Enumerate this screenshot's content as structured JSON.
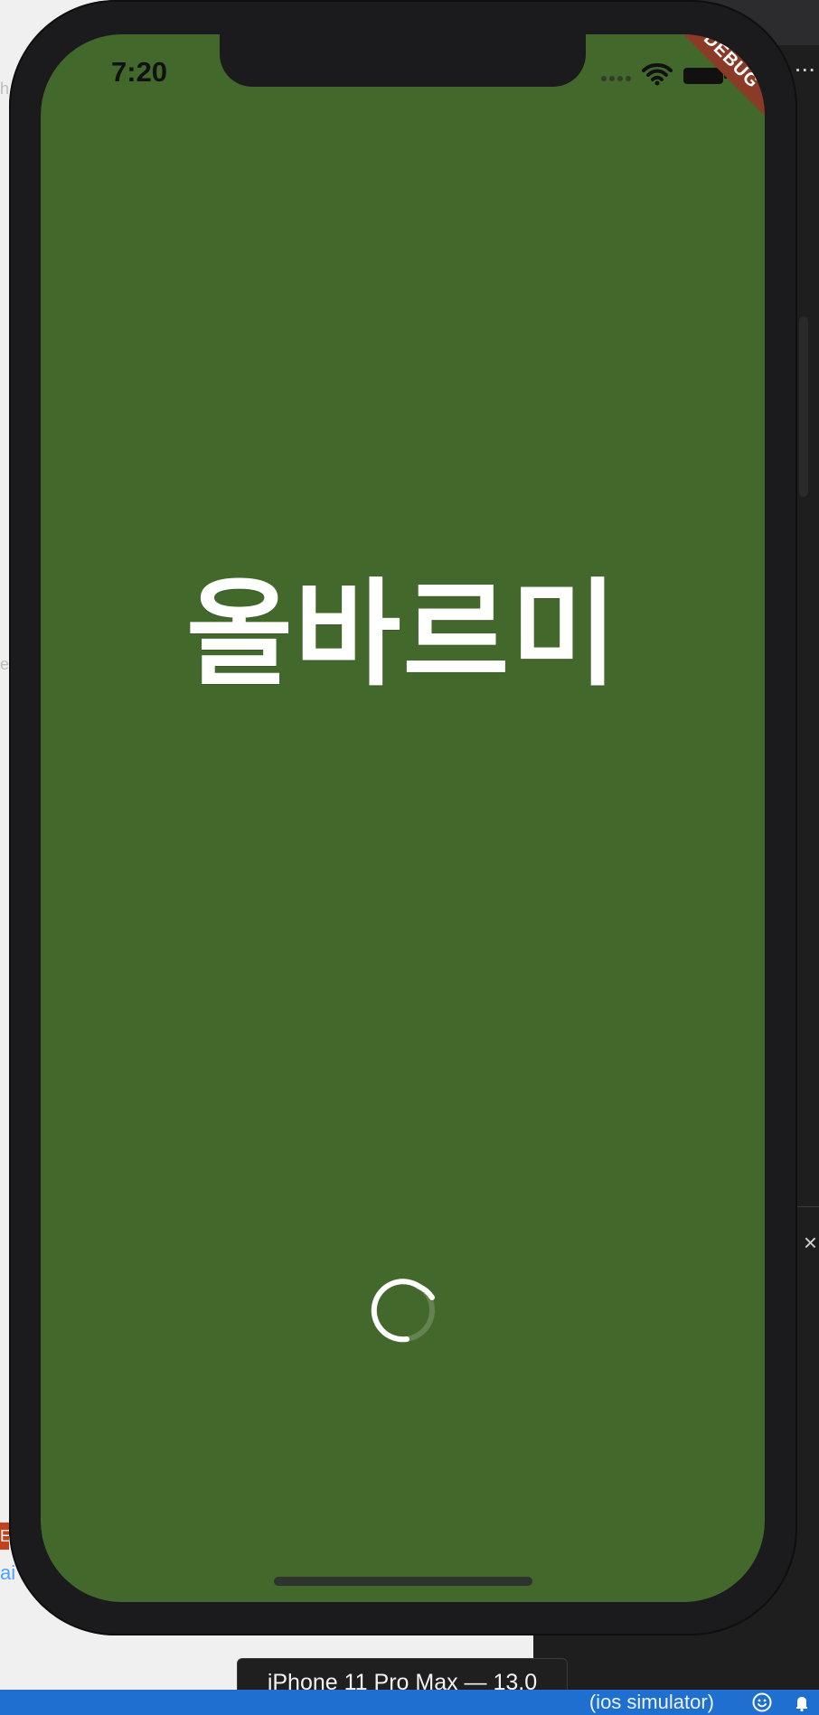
{
  "editor": {
    "left_text_h": "h",
    "left_text_e": "e",
    "left_text_red": "E",
    "left_text_ai": "ai",
    "right_ellipsis": "...",
    "right_close": "×"
  },
  "simulator": {
    "window_title": "iPhone 11 Pro Max — 13.0",
    "status_time": "7:20",
    "debug_banner": "DEBUG",
    "app_title": "올바르미",
    "background_color": "#43682b"
  },
  "status_bar": {
    "device_text": "(ios simulator)",
    "icons": [
      "smile-icon",
      "bell-icon"
    ]
  },
  "phone_status_icons": [
    "wifi-icon",
    "battery-icon"
  ],
  "loading": {
    "indicator": "spinner"
  }
}
